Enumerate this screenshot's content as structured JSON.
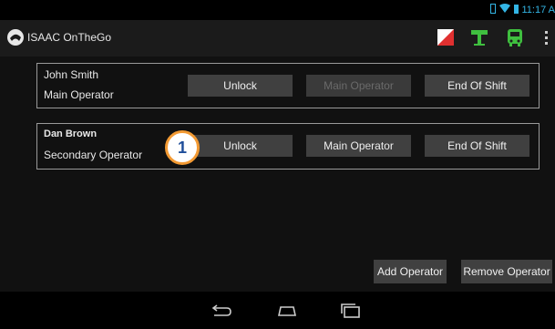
{
  "app": {
    "title": "ISAAC OnTheGo"
  },
  "status_bar": {
    "time": "11:17 A"
  },
  "operators": [
    {
      "name": "John Smith",
      "role": "Main Operator",
      "buttons": {
        "unlock": "Unlock",
        "main_operator": "Main Operator",
        "end_of_shift": "End Of Shift"
      },
      "main_operator_enabled": false
    },
    {
      "name": "Dan Brown",
      "role": "Secondary Operator",
      "buttons": {
        "unlock": "Unlock",
        "main_operator": "Main Operator",
        "end_of_shift": "End Of Shift"
      },
      "main_operator_enabled": true
    }
  ],
  "callout": {
    "number": "1",
    "color": "#f39a33"
  },
  "footer": {
    "add_operator": "Add Operator",
    "remove_operator": "Remove Operator"
  },
  "icons": {
    "action_bar": [
      "flag-icon",
      "signpost-icon",
      "bus-icon",
      "overflow-menu-icon"
    ],
    "nav_bar": [
      "back-icon",
      "home-icon",
      "recent-apps-icon"
    ],
    "status": [
      "sim-icon",
      "wifi-icon",
      "battery-icon"
    ]
  },
  "colors": {
    "accent_green": "#3fbf3f",
    "flag_red": "#e03030",
    "callout_orange": "#f39a33",
    "callout_text": "#1f4e9a"
  }
}
